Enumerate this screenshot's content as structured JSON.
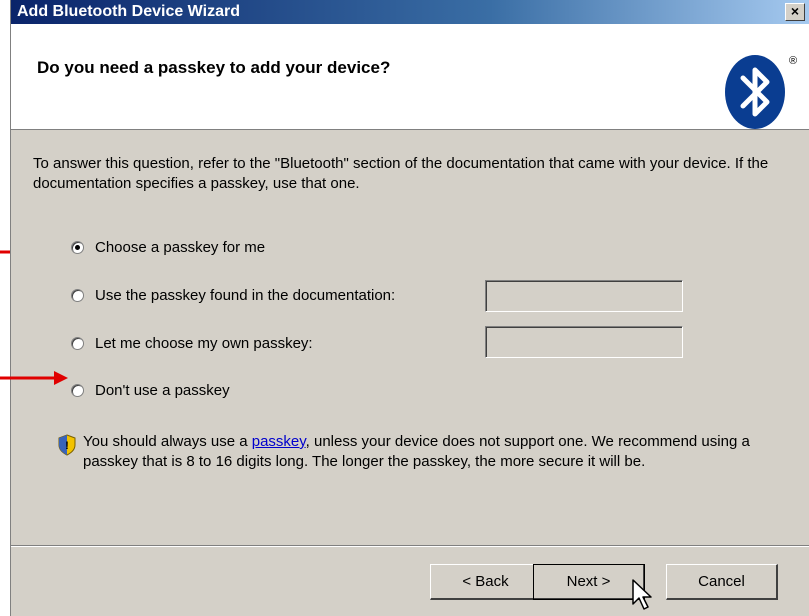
{
  "window": {
    "title": "Add Bluetooth Device Wizard",
    "close_glyph": "×"
  },
  "header": {
    "title": "Do you need a passkey to add your device?",
    "logo_icon": "bluetooth-logo",
    "trademark": "®"
  },
  "description": "To answer this question, refer to the \"Bluetooth\" section of the documentation that came with your device. If the documentation specifies a passkey, use that one.",
  "options": [
    {
      "label": "Choose a passkey for me",
      "checked": true
    },
    {
      "label": "Use the passkey found in the documentation:",
      "checked": false,
      "field_value": ""
    },
    {
      "label": "Let me choose my own passkey:",
      "checked": false,
      "field_value": ""
    },
    {
      "label": "Don't use a passkey",
      "checked": false
    }
  ],
  "info": {
    "icon": "security-shield-icon",
    "before": "You should always use a ",
    "link": "passkey",
    "after": ", unless your device does not support one. We recommend using a passkey that is 8 to 16 digits long. The longer the passkey, the more secure it will be."
  },
  "buttons": {
    "back": "< Back",
    "next": "Next >",
    "cancel": "Cancel"
  },
  "colors": {
    "title_bar": "#0a246a",
    "arrow": "#e00000",
    "dialog_bg": "#d4d0c8",
    "link": "#0000cc"
  }
}
